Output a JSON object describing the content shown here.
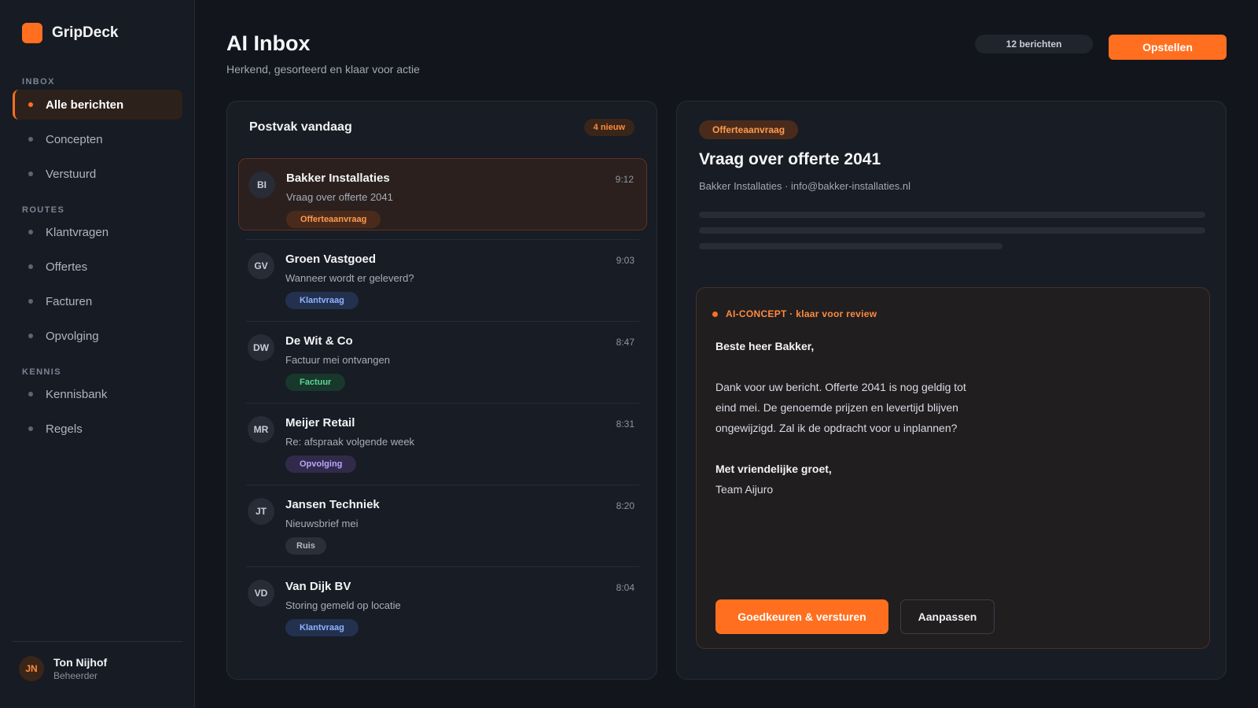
{
  "brand": {
    "name": "GripDeck",
    "color": "#ff6f1f"
  },
  "sidebar": {
    "sections": {
      "inbox": "INBOX",
      "routes": "ROUTES",
      "kennis": "KENNIS"
    },
    "inbox_items": [
      {
        "label": "Alle berichten",
        "active": true
      },
      {
        "label": "Concepten"
      },
      {
        "label": "Verstuurd"
      }
    ],
    "route_items": [
      {
        "label": "Klantvragen"
      },
      {
        "label": "Offertes"
      },
      {
        "label": "Facturen"
      },
      {
        "label": "Opvolging"
      }
    ],
    "kennis_items": [
      {
        "label": "Kennisbank"
      },
      {
        "label": "Regels"
      }
    ]
  },
  "user": {
    "initials": "JN",
    "name": "Ton Nijhof",
    "role": "Beheerder"
  },
  "header": {
    "title": "AI Inbox",
    "subtitle": "Herkend, gesorteerd en klaar voor actie",
    "count": "12 berichten",
    "compose_label": "Opstellen"
  },
  "inbox": {
    "title": "Postvak vandaag",
    "new_badge": "4 nieuw",
    "messages": [
      {
        "initials": "BI",
        "sender": "Bakker Installaties",
        "time": "9:12",
        "subject": "Vraag over offerte 2041",
        "tag": "Offerteaanvraag",
        "selected": true
      },
      {
        "initials": "GV",
        "sender": "Groen Vastgoed",
        "time": "9:03",
        "subject": "Wanneer wordt er geleverd?",
        "tag": "Klantvraag"
      },
      {
        "initials": "DW",
        "sender": "De Wit & Co",
        "time": "8:47",
        "subject": "Factuur mei ontvangen",
        "tag": "Factuur"
      },
      {
        "initials": "MR",
        "sender": "Meijer Retail",
        "time": "8:31",
        "subject": "Re: afspraak volgende week",
        "tag": "Opvolging"
      },
      {
        "initials": "JT",
        "sender": "Jansen Techniek",
        "time": "8:20",
        "subject": "Nieuwsbrief mei",
        "tag": "Ruis"
      },
      {
        "initials": "VD",
        "sender": "Van Dijk BV",
        "time": "8:04",
        "subject": "Storing gemeld op locatie",
        "tag": "Klantvraag"
      }
    ]
  },
  "detail": {
    "tag": "Offerteaanvraag",
    "subject": "Vraag over offerte 2041",
    "from": "Bakker Installaties · info@bakker-installaties.nl",
    "ai": {
      "label": "AI-CONCEPT · klaar voor review",
      "greeting": "Beste heer Bakker,",
      "body_lines": [
        "Dank voor uw bericht. Offerte 2041 is nog geldig tot",
        "eind mei. De genoemde prijzen en levertijd blijven",
        "ongewijzigd. Zal ik de opdracht voor u inplannen?"
      ],
      "closing": "Met vriendelijke groet,",
      "signature": "Team Aijuro",
      "approve_label": "Goedkeuren & versturen",
      "edit_label": "Aanpassen"
    }
  }
}
